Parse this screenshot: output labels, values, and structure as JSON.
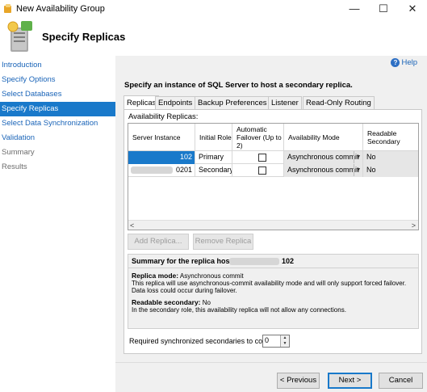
{
  "window": {
    "title": "New Availability Group",
    "minimize": "—",
    "maximize": "☐",
    "close": "✕"
  },
  "header": {
    "title": "Specify Replicas"
  },
  "nav": {
    "items": [
      {
        "label": "Introduction",
        "state": "link"
      },
      {
        "label": "Specify Options",
        "state": "link"
      },
      {
        "label": "Select Databases",
        "state": "link"
      },
      {
        "label": "Specify Replicas",
        "state": "selected"
      },
      {
        "label": "Select Data Synchronization",
        "state": "link"
      },
      {
        "label": "Validation",
        "state": "link"
      },
      {
        "label": "Summary",
        "state": "disabled"
      },
      {
        "label": "Results",
        "state": "disabled"
      }
    ]
  },
  "main": {
    "help": "Help",
    "instruction": "Specify an instance of SQL Server to host a secondary replica.",
    "tabs": [
      "Replicas",
      "Endpoints",
      "Backup Preferences",
      "Listener",
      "Read-Only Routing"
    ],
    "availability_label": "Availability Replicas:",
    "grid": {
      "columns": [
        "Server Instance",
        "Initial Role",
        "Automatic Failover (Up to 2)",
        "Availability Mode",
        "Readable Secondary"
      ],
      "rows": [
        {
          "server_suffix": "102",
          "role": "Primary",
          "failover": false,
          "mode": "Asynchronous commit",
          "readable": "No"
        },
        {
          "server_suffix": "0201",
          "role": "Secondary",
          "failover": false,
          "mode": "Asynchronous commit",
          "readable": "No"
        }
      ]
    },
    "add_replica": "Add Replica...",
    "remove_replica": "Remove Replica",
    "summary": {
      "title": "Summary for the replica hosted by",
      "host_suffix": "102",
      "mode_label": "Replica mode:",
      "mode_value": "Asynchronous commit",
      "mode_desc": "This replica will use asynchronous-commit availability mode and will only support forced failover. Data loss could occur during failover.",
      "readable_label": "Readable secondary:",
      "readable_value": "No",
      "readable_desc": "In the secondary role, this availability replica will not allow any connections."
    },
    "required_label": "Required synchronized secondaries to commit",
    "required_value": "0"
  },
  "footer": {
    "previous": "< Previous",
    "next": "Next >",
    "cancel": "Cancel"
  },
  "colors": {
    "accent": "#1979ca",
    "link": "#1a64b8"
  }
}
